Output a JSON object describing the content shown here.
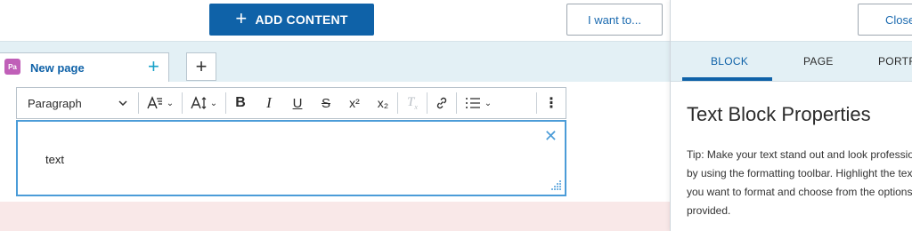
{
  "header": {
    "add_content_label": "ADD CONTENT",
    "i_want_to_label": "I want to..."
  },
  "tabs": {
    "page_tab_badge": "Pa",
    "page_tab_label": "New page"
  },
  "toolbar": {
    "format_select_value": "Paragraph",
    "buttons": [
      "font-style-icon",
      "text-size-icon",
      "bold-icon",
      "italic-icon",
      "underline-icon",
      "strikethrough-icon",
      "superscript-icon",
      "subscript-icon",
      "clear-formatting-icon",
      "link-icon",
      "list-icon",
      "more-options-icon"
    ]
  },
  "text_block": {
    "content": "text"
  },
  "panel": {
    "close_label": "Close",
    "tabs": [
      "BLOCK",
      "PAGE",
      "PORTFO"
    ],
    "active_tab": "BLOCK",
    "title": "Text Block Properties",
    "tip_lines": [
      "Tip: Make your text stand out and look professio",
      "by using the formatting toolbar. Highlight the tex",
      "you want to format and choose from the options",
      "provided."
    ]
  },
  "colors": {
    "accent": "#0f62a8",
    "tab_strip_bg": "#e3f0f5",
    "selection_border": "#4b9cd8",
    "page_badge": "#c05fb8",
    "pink_band": "#f9e8e8"
  }
}
